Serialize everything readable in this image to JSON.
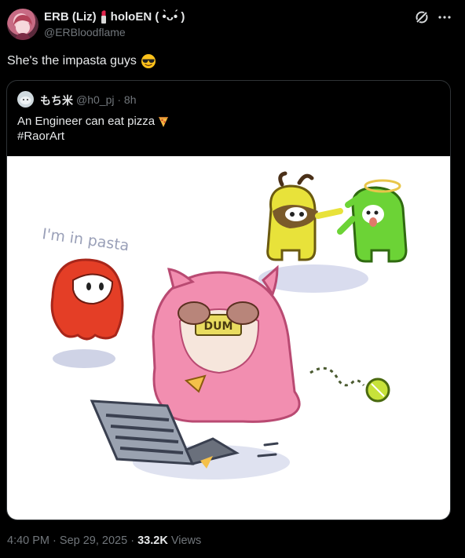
{
  "tweet": {
    "display_name": "ERB (Liz)",
    "name_suffix": "holoEN ( •̀ᴗ•́ )",
    "handle": "@ERBloodflame",
    "text": "She's the impasta guys",
    "avatar_icon": "avatar-icon",
    "lipstick_icon": "lipstick-icon",
    "sunglasses_icon": "sunglasses-emoji-icon",
    "action_icons": [
      "grok-icon",
      "more-icon"
    ]
  },
  "quote": {
    "display_name": "もち米",
    "handle": "@h0_pj",
    "separator": "·",
    "time": "8h",
    "line1": "An Engineer can eat pizza",
    "line2": "#RaorArt",
    "pizza_icon": "pizza-emoji-icon",
    "art_caption": "I'm in pasta",
    "art_sign": "DUM"
  },
  "footer": {
    "time": "4:40 PM",
    "separator": "·",
    "date": "Sep 29, 2025",
    "views_count": "33.2K",
    "views_label": "Views"
  }
}
